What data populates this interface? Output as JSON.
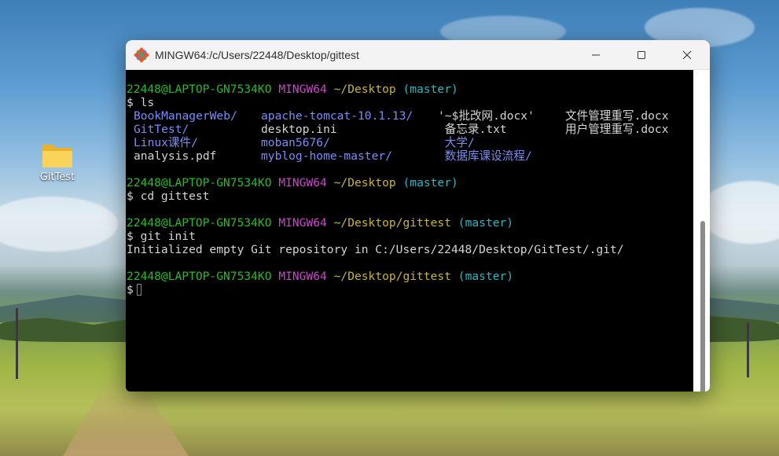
{
  "desktop": {
    "icons": [
      {
        "label": "GitTest",
        "icon": "folder-icon"
      }
    ]
  },
  "window": {
    "title": "MINGW64:/c/Users/22448/Desktop/gittest",
    "app_icon": "git-bash-icon",
    "buttons": {
      "minimize": "minimize-icon",
      "maximize": "maximize-icon",
      "close": "close-icon"
    }
  },
  "terminal": {
    "colors": {
      "user": "#25bc24",
      "shell": "#c848c8",
      "path": "#c9b43a",
      "branch": "#2ab7bf",
      "dir": "#7b8cf5",
      "text": "#d4d4d4"
    },
    "prompts": [
      {
        "user": "22448@LAPTOP-GN7534KO",
        "shell": "MINGW64",
        "path": "~/Desktop",
        "branch": "(master)"
      },
      {
        "user": "22448@LAPTOP-GN7534KO",
        "shell": "MINGW64",
        "path": "~/Desktop",
        "branch": "(master)"
      },
      {
        "user": "22448@LAPTOP-GN7534KO",
        "shell": "MINGW64",
        "path": "~/Desktop/gittest",
        "branch": "(master)"
      },
      {
        "user": "22448@LAPTOP-GN7534KO",
        "shell": "MINGW64",
        "path": "~/Desktop/gittest",
        "branch": "(master)"
      }
    ],
    "commands": [
      "$ ls",
      "$ cd gittest",
      "$ git init",
      "$"
    ],
    "ls_output": [
      [
        "BookManagerWeb/",
        "apache-tomcat-10.1.13/",
        "'~$批改网.docx'",
        "文件管理重写.docx"
      ],
      [
        "GitTest/",
        "desktop.ini",
        " 备忘录.txt",
        "用户管理重写.docx"
      ],
      [
        "Linux课件/",
        "moban5676/",
        " 大学/",
        ""
      ],
      [
        "analysis.pdf",
        "myblog-home-master/",
        " 数据库课设流程/",
        ""
      ]
    ],
    "init_output": "Initialized empty Git repository in C:/Users/22448/Desktop/GitTest/.git/"
  }
}
